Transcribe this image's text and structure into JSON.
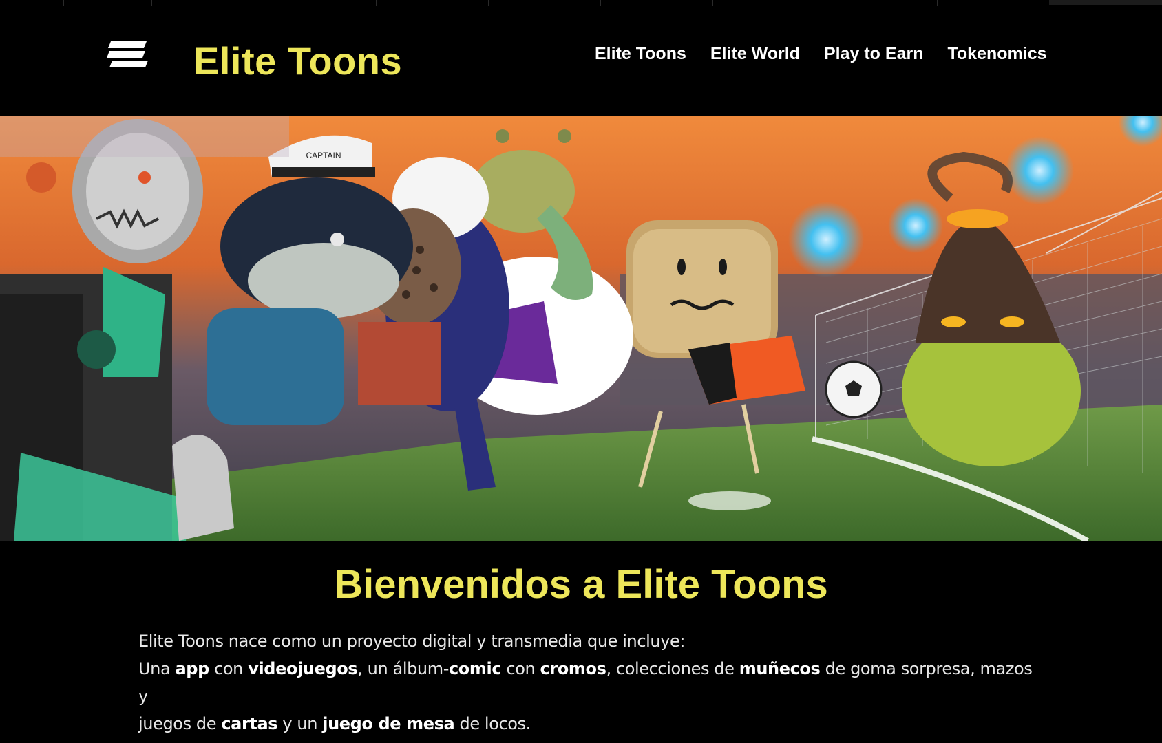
{
  "colors": {
    "background": "#000000",
    "brand_yellow": "#ede65a",
    "nav_text": "#ffffff",
    "body_text": "#e8e8e8"
  },
  "header": {
    "logo_icon": "stacked-bars-logo-icon",
    "brand_title": "Elite Toons",
    "nav": [
      {
        "label": "Elite Toons"
      },
      {
        "label": "Elite World"
      },
      {
        "label": "Play to Earn"
      },
      {
        "label": "Tokenomics"
      }
    ]
  },
  "hero": {
    "image_description_icon": "football-cartoon-characters-banner",
    "cap_text": "CAPTAIN"
  },
  "main": {
    "welcome_title": "Bienvenidos a Elite Toons",
    "intro_line1": "Elite Toons nace como un proyecto digital y  transmedia que incluye:",
    "intro_line2": [
      {
        "text": "Una ",
        "bold": false
      },
      {
        "text": "app",
        "bold": true
      },
      {
        "text": " con ",
        "bold": false
      },
      {
        "text": "videojuegos",
        "bold": true
      },
      {
        "text": ", un álbum-",
        "bold": false
      },
      {
        "text": "comic",
        "bold": true
      },
      {
        "text": " con ",
        "bold": false
      },
      {
        "text": "cromos",
        "bold": true
      },
      {
        "text": ", colecciones de ",
        "bold": false
      },
      {
        "text": "muñecos",
        "bold": true
      },
      {
        "text": " de goma sorpresa, mazos y",
        "bold": false
      }
    ],
    "intro_line3": [
      {
        "text": "juegos de ",
        "bold": false
      },
      {
        "text": "cartas",
        "bold": true
      },
      {
        "text": " y un ",
        "bold": false
      },
      {
        "text": "juego de mesa",
        "bold": true
      },
      {
        "text": " de locos.",
        "bold": false
      }
    ]
  }
}
